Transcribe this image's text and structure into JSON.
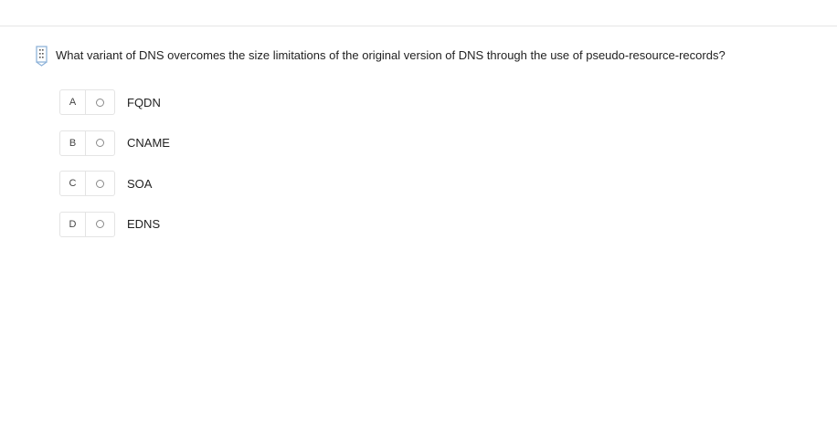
{
  "question": {
    "text": "What variant of DNS overcomes the size limitations of the original version of DNS through the use of pseudo-resource-records?",
    "icon": "bookmark-flag-icon"
  },
  "options": [
    {
      "letter": "A",
      "label": "FQDN"
    },
    {
      "letter": "B",
      "label": "CNAME"
    },
    {
      "letter": "C",
      "label": "SOA"
    },
    {
      "letter": "D",
      "label": "EDNS"
    }
  ],
  "colors": {
    "border": "#e4e4e4",
    "icon_accent": "#8fb3d9",
    "text": "#222222"
  }
}
